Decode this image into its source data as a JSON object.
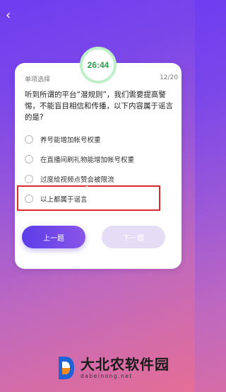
{
  "timer": "26:44",
  "question": {
    "type_label": "单项选择",
    "counter": "12/20",
    "text": "听到所谓的平台“潜规则”，我们需要提高警惕，不能盲目相信和传播，以下内容属于谣言的是?"
  },
  "options": [
    {
      "label": "养号能增加帐号权重"
    },
    {
      "label": "在直播间刷礼物能增加帐号权重"
    },
    {
      "label": "过度给视频点赞会被限流"
    },
    {
      "label": "以上都属于谣言"
    }
  ],
  "buttons": {
    "prev": "上一题",
    "next": "下一题"
  },
  "watermark": {
    "brand": "大北农软件园",
    "domain": "dabeinong.net"
  },
  "colors": {
    "timer_text": "#2e9b4e",
    "highlight": "#d92b2b",
    "prev_button": "#5b3ce8"
  }
}
